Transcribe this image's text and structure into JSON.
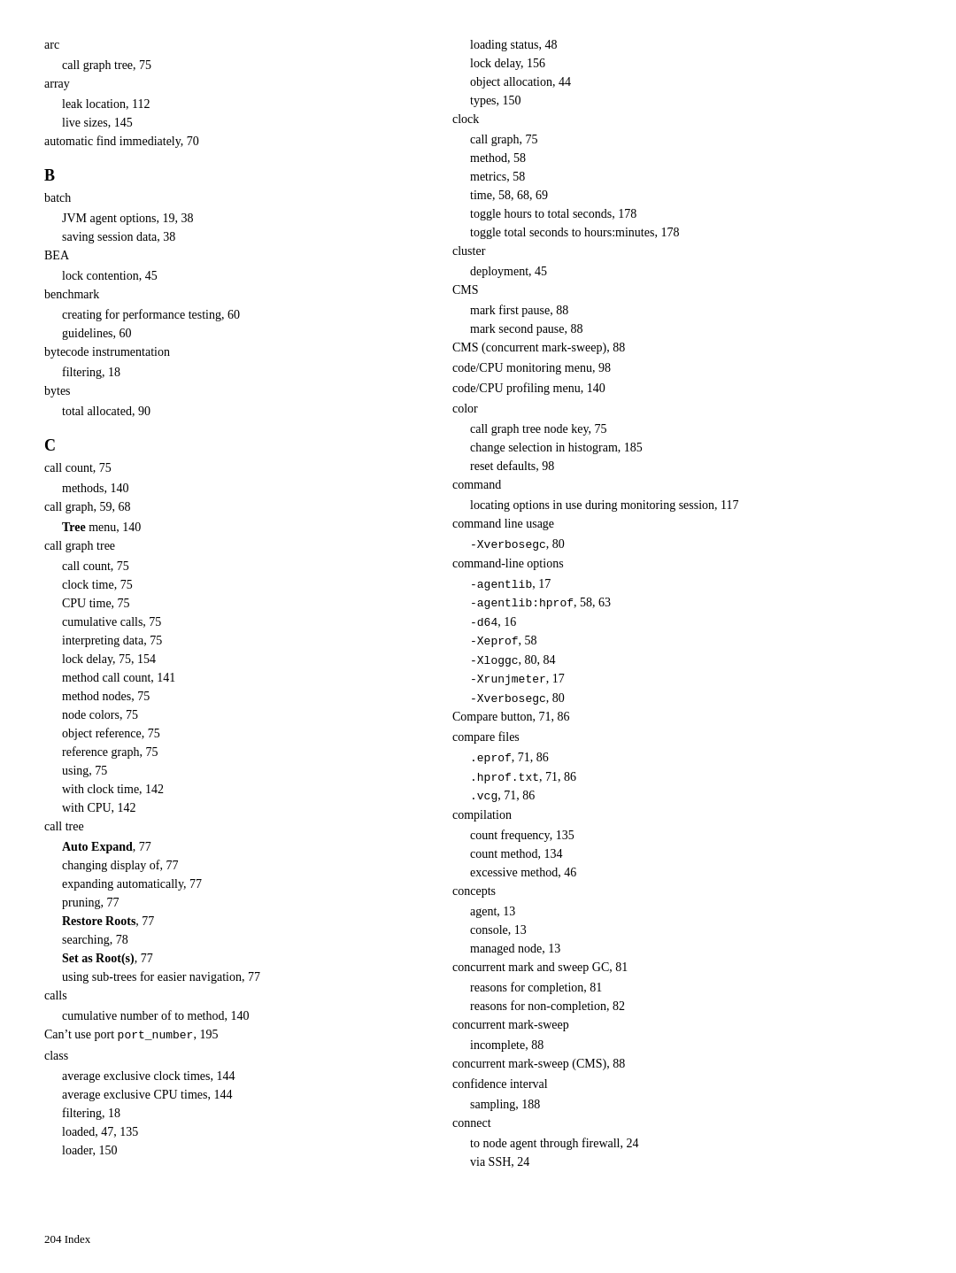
{
  "footer": {
    "text": "204     Index"
  },
  "left_column": [
    {
      "type": "term",
      "text": "arc"
    },
    {
      "type": "sub",
      "text": "call graph tree, 75"
    },
    {
      "type": "term",
      "text": "array"
    },
    {
      "type": "sub",
      "text": "leak location, 112"
    },
    {
      "type": "sub",
      "text": "live sizes, 145"
    },
    {
      "type": "term",
      "text": "automatic find immediately, 70"
    },
    {
      "type": "section",
      "text": "B"
    },
    {
      "type": "term",
      "text": "batch"
    },
    {
      "type": "sub",
      "text": "JVM agent options, 19, 38"
    },
    {
      "type": "sub",
      "text": "saving session data, 38"
    },
    {
      "type": "term",
      "text": "BEA"
    },
    {
      "type": "sub",
      "text": "lock contention, 45"
    },
    {
      "type": "term",
      "text": "benchmark"
    },
    {
      "type": "sub",
      "text": "creating for performance testing, 60"
    },
    {
      "type": "sub",
      "text": "guidelines, 60"
    },
    {
      "type": "term",
      "text": "bytecode instrumentation"
    },
    {
      "type": "sub",
      "text": "filtering, 18"
    },
    {
      "type": "term",
      "text": "bytes"
    },
    {
      "type": "sub",
      "text": "total allocated, 90"
    },
    {
      "type": "section",
      "text": "C"
    },
    {
      "type": "term",
      "text": "call count, 75"
    },
    {
      "type": "sub",
      "text": "methods, 140"
    },
    {
      "type": "term",
      "text": "call graph, 59, 68"
    },
    {
      "type": "sub",
      "text": "Tree menu, 140",
      "bold": true,
      "bold_part": "Tree"
    },
    {
      "type": "term",
      "text": "call graph tree"
    },
    {
      "type": "sub",
      "text": "call count, 75"
    },
    {
      "type": "sub",
      "text": "clock time, 75"
    },
    {
      "type": "sub",
      "text": "CPU time, 75"
    },
    {
      "type": "sub",
      "text": "cumulative calls, 75"
    },
    {
      "type": "sub",
      "text": "interpreting data, 75"
    },
    {
      "type": "sub",
      "text": "lock delay, 75, 154"
    },
    {
      "type": "sub",
      "text": "method call count, 141"
    },
    {
      "type": "sub",
      "text": "method nodes, 75"
    },
    {
      "type": "sub",
      "text": "node colors, 75"
    },
    {
      "type": "sub",
      "text": "object reference, 75"
    },
    {
      "type": "sub",
      "text": "reference graph, 75"
    },
    {
      "type": "sub",
      "text": "using, 75"
    },
    {
      "type": "sub",
      "text": "with clock time, 142"
    },
    {
      "type": "sub",
      "text": "with CPU, 142"
    },
    {
      "type": "term",
      "text": "call tree"
    },
    {
      "type": "sub",
      "bold_part": "Auto Expand",
      "text": "Auto Expand, 77"
    },
    {
      "type": "sub",
      "text": "changing display of, 77"
    },
    {
      "type": "sub",
      "text": "expanding automatically, 77"
    },
    {
      "type": "sub",
      "text": "pruning, 77"
    },
    {
      "type": "sub",
      "bold_part": "Restore Roots",
      "text": "Restore Roots, 77"
    },
    {
      "type": "sub",
      "text": "searching, 78"
    },
    {
      "type": "sub",
      "bold_part": "Set as Root(s)",
      "text": "Set as Root(s), 77"
    },
    {
      "type": "sub",
      "text": "using sub-trees for easier navigation, 77"
    },
    {
      "type": "term",
      "text": "calls"
    },
    {
      "type": "sub",
      "text": "cumulative number of to method, 140"
    },
    {
      "type": "term",
      "text": "Can’t use port port_number, 195",
      "has_code": true,
      "code_part": "port_number"
    },
    {
      "type": "term",
      "text": "class"
    },
    {
      "type": "sub",
      "text": "average exclusive clock times, 144"
    },
    {
      "type": "sub",
      "text": "average exclusive CPU times, 144"
    },
    {
      "type": "sub",
      "text": "filtering, 18"
    },
    {
      "type": "sub",
      "text": "loaded, 47, 135"
    },
    {
      "type": "sub",
      "text": "loader, 150"
    }
  ],
  "right_column": [
    {
      "type": "sub",
      "text": "loading status, 48"
    },
    {
      "type": "sub",
      "text": "lock delay, 156"
    },
    {
      "type": "sub",
      "text": "object allocation, 44"
    },
    {
      "type": "sub",
      "text": "types, 150"
    },
    {
      "type": "term",
      "text": "clock"
    },
    {
      "type": "sub",
      "text": "call graph, 75"
    },
    {
      "type": "sub",
      "text": "method, 58"
    },
    {
      "type": "sub",
      "text": "metrics, 58"
    },
    {
      "type": "sub",
      "text": "time, 58, 68, 69"
    },
    {
      "type": "sub",
      "text": "toggle hours to total seconds, 178"
    },
    {
      "type": "sub",
      "text": "toggle total seconds to hours:minutes, 178"
    },
    {
      "type": "term",
      "text": "cluster"
    },
    {
      "type": "sub",
      "text": "deployment, 45"
    },
    {
      "type": "term",
      "text": "CMS"
    },
    {
      "type": "sub",
      "text": "mark first pause, 88"
    },
    {
      "type": "sub",
      "text": "mark second pause, 88"
    },
    {
      "type": "term",
      "text": "CMS (concurrent mark-sweep), 88"
    },
    {
      "type": "term",
      "text": "code/CPU monitoring menu, 98"
    },
    {
      "type": "term",
      "text": "code/CPU profiling menu, 140"
    },
    {
      "type": "term",
      "text": "color"
    },
    {
      "type": "sub",
      "text": "call graph tree node key, 75"
    },
    {
      "type": "sub",
      "text": "change selection in histogram, 185"
    },
    {
      "type": "sub",
      "text": "reset defaults, 98"
    },
    {
      "type": "term",
      "text": "command"
    },
    {
      "type": "sub",
      "text": "locating options in use during monitoring session, 117"
    },
    {
      "type": "term",
      "text": "command line usage"
    },
    {
      "type": "sub",
      "text": "-Xverbosegc, 80",
      "has_code": true,
      "code_part": "-Xverbosegc"
    },
    {
      "type": "term",
      "text": "command-line options"
    },
    {
      "type": "sub",
      "text": "-agentlib, 17",
      "has_code": true,
      "code_part": "-agentlib"
    },
    {
      "type": "sub",
      "text": "-agentlib:hprof, 58, 63",
      "has_code": true,
      "code_part": "-agentlib:hprof"
    },
    {
      "type": "sub",
      "text": "-d64, 16",
      "has_code": true,
      "code_part": "-d64"
    },
    {
      "type": "sub",
      "text": "-Xeprof, 58",
      "has_code": true,
      "code_part": "-Xeprof"
    },
    {
      "type": "sub",
      "text": "-Xloggc, 80, 84",
      "has_code": true,
      "code_part": "-Xloggc"
    },
    {
      "type": "sub",
      "text": "-Xrunjmeter, 17",
      "has_code": true,
      "code_part": "-Xrunjmeter"
    },
    {
      "type": "sub",
      "text": "-Xverbosegc, 80",
      "has_code": true,
      "code_part": "-Xverbosegc"
    },
    {
      "type": "term",
      "text": "Compare button, 71, 86"
    },
    {
      "type": "term",
      "text": "compare files"
    },
    {
      "type": "sub",
      "text": ".eprof, 71, 86",
      "has_code": true,
      "code_part": ".eprof"
    },
    {
      "type": "sub",
      "text": ".hprof.txt, 71, 86",
      "has_code": true,
      "code_part": ".hprof.txt"
    },
    {
      "type": "sub",
      "text": ".vcg, 71, 86",
      "has_code": true,
      "code_part": ".vcg"
    },
    {
      "type": "term",
      "text": "compilation"
    },
    {
      "type": "sub",
      "text": "count frequency, 135"
    },
    {
      "type": "sub",
      "text": "count method, 134"
    },
    {
      "type": "sub",
      "text": "excessive method, 46"
    },
    {
      "type": "term",
      "text": "concepts"
    },
    {
      "type": "sub",
      "text": "agent, 13"
    },
    {
      "type": "sub",
      "text": "console, 13"
    },
    {
      "type": "sub",
      "text": "managed node, 13"
    },
    {
      "type": "term",
      "text": "concurrent mark and sweep GC, 81"
    },
    {
      "type": "sub",
      "text": "reasons for completion, 81"
    },
    {
      "type": "sub",
      "text": "reasons for non-completion, 82"
    },
    {
      "type": "term",
      "text": "concurrent mark-sweep"
    },
    {
      "type": "sub",
      "text": "incomplete, 88"
    },
    {
      "type": "term",
      "text": "concurrent mark-sweep (CMS), 88"
    },
    {
      "type": "term",
      "text": "confidence interval"
    },
    {
      "type": "sub",
      "text": "sampling, 188"
    },
    {
      "type": "term",
      "text": "connect"
    },
    {
      "type": "sub",
      "text": "to node agent through firewall, 24"
    },
    {
      "type": "sub",
      "text": "via SSH, 24"
    }
  ]
}
